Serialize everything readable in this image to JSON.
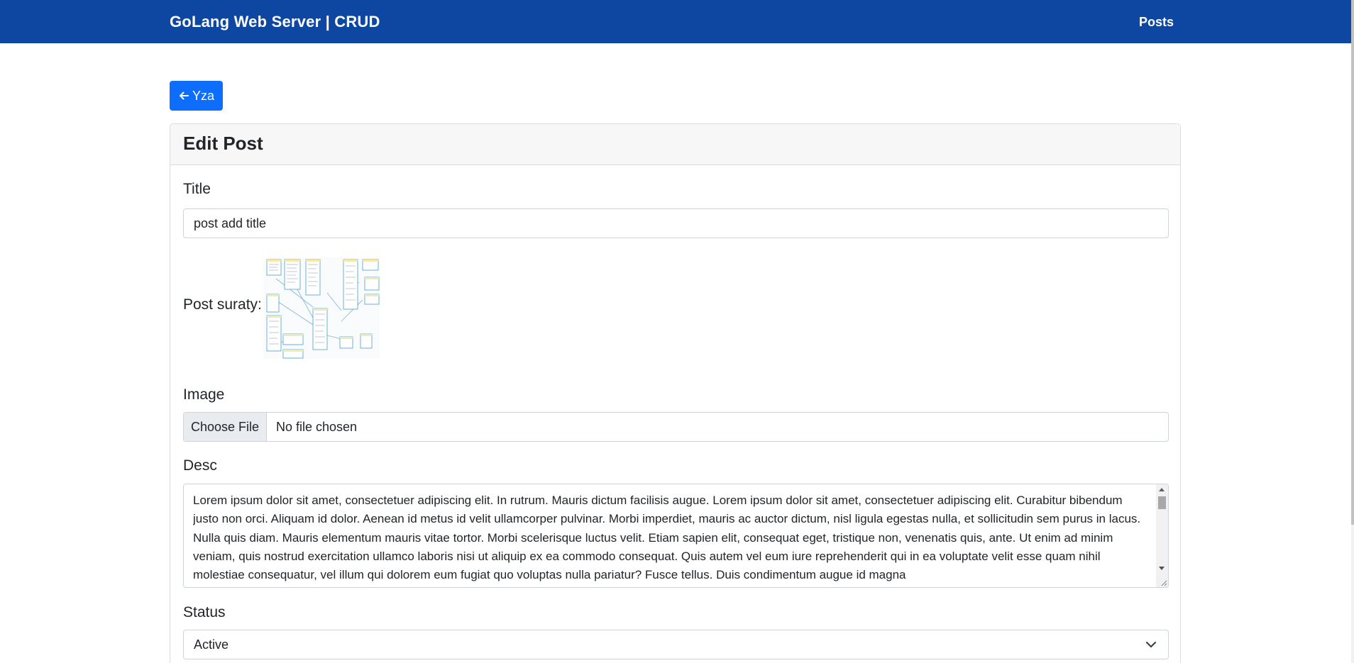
{
  "navbar": {
    "brand": "GoLang Web Server | CRUD",
    "posts_link": "Posts",
    "background": "#0d47a1"
  },
  "back_button": {
    "label": "Yza",
    "icon": "arrow-left-icon",
    "color": "#0d6efd"
  },
  "card": {
    "title": "Edit Post"
  },
  "form": {
    "title_label": "Title",
    "title_value": "post add title",
    "image_preview_label": "Post suraty:",
    "image_label": "Image",
    "file_button": "Choose File",
    "file_status": "No file chosen",
    "desc_label": "Desc",
    "desc_value": "Lorem ipsum dolor sit amet, consectetuer adipiscing elit. In rutrum. Mauris dictum facilisis augue. Lorem ipsum dolor sit amet, consectetuer adipiscing elit. Curabitur bibendum justo non orci. Aliquam id dolor. Aenean id metus id velit ullamcorper pulvinar. Morbi imperdiet, mauris ac auctor dictum, nisl ligula egestas nulla, et sollicitudin sem purus in lacus. Nulla quis diam. Mauris elementum mauris vitae tortor. Morbi scelerisque luctus velit. Etiam sapien elit, consequat eget, tristique non, venenatis quis, ante. Ut enim ad minim veniam, quis nostrud exercitation ullamco laboris nisi ut aliquip ex ea commodo consequat. Quis autem vel eum iure reprehenderit qui in ea voluptate velit esse quam nihil molestiae consequatur, vel illum qui dolorem eum fugiat quo voluptas nulla pariatur? Fusce tellus. Duis condimentum augue id magna",
    "status_label": "Status",
    "status_value": "Active"
  }
}
